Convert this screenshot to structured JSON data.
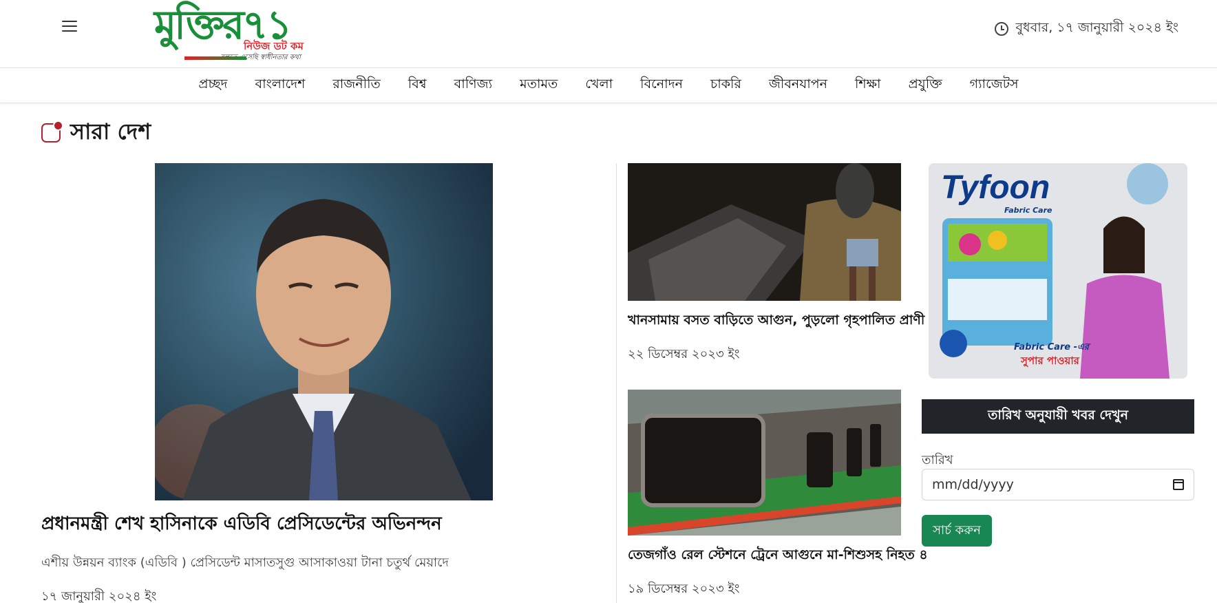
{
  "header": {
    "menu_icon": "hamburger-icon",
    "logo": {
      "main": "মুক্তির৭১",
      "sub": "নিউজ ডট কম",
      "tagline": "বলতে এসেছি স্বাধীনতার কথা"
    },
    "clock_icon": "clock-icon",
    "date": "বুধবার, ১৭ জানুয়ারী ২০২৪ ইং"
  },
  "nav": {
    "items": [
      "প্রচ্ছদ",
      "বাংলাদেশ",
      "রাজনীতি",
      "বিশ্ব",
      "বাণিজ্য",
      "মতামত",
      "খেলা",
      "বিনোদন",
      "চাকরি",
      "জীবনযাপন",
      "শিক্ষা",
      "প্রযুক্তি",
      "গ্যাজেটস"
    ]
  },
  "section": {
    "icon": "category-icon",
    "title": "সারা দেশ"
  },
  "lead": {
    "title": "প্রধানমন্ত্রী শেখ হাসিনাকে এডিবি প্রেসিডেন্টের অভিনন্দন",
    "excerpt": "এশীয় উন্নয়ন ব্যাংক (এডিবি ) প্রেসিডেন্ট মাসাতসুগু আসাকাওয়া টানা চতুর্থ মেয়াদে",
    "date": "১৭ জানুয়ারী ২০২৪ ইং"
  },
  "stories": [
    {
      "title": "খানসামায় বসত বাড়িতে আগুন, পুড়লো গৃহপালিত প্রাণী",
      "date": "২২ ডিসেম্বর ২০২৩ ইং"
    },
    {
      "title": "তেজগাঁও রেল স্টেশনে ট্রেনে আগুনে মা-শিশুসহ নিহত ৪",
      "date": "১৯ ডিসেম্বর ২০২৩ ইং"
    }
  ],
  "ad": {
    "brand": "Tyfoon",
    "fabric": "Fabric Care",
    "line1": "Fabric Care -এর",
    "line2": "সুপার পাওয়ার"
  },
  "archive": {
    "heading": "তারিখ অনুযায়ী খবর দেখুন",
    "label": "তারিখ",
    "placeholder": "mm/dd/yyyy",
    "button": "সার্চ করুন"
  },
  "colors": {
    "accent_red": "#b5202a",
    "brand_green": "#1a8f3a",
    "button_green": "#198754",
    "dark_header": "#212529"
  }
}
